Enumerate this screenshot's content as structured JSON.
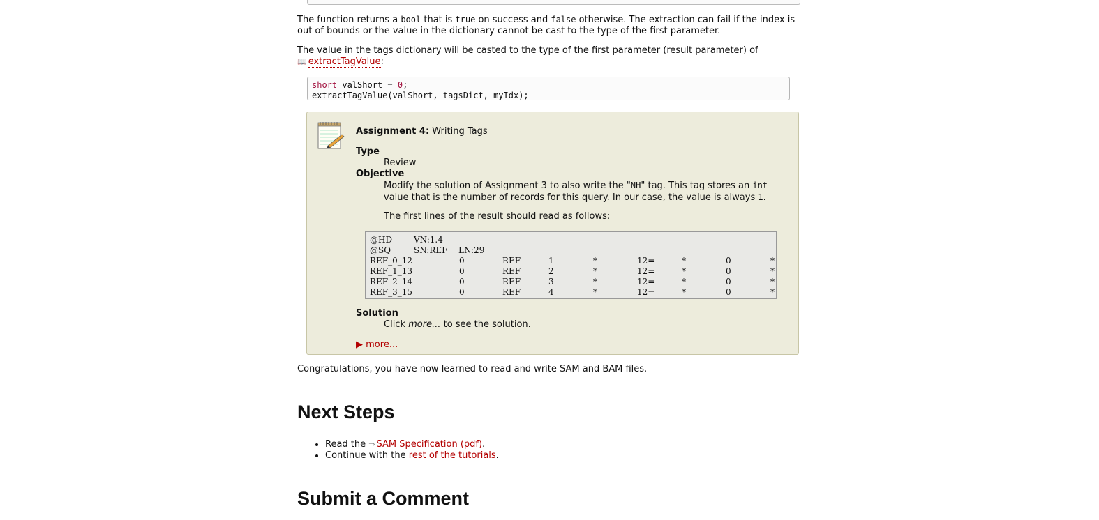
{
  "para1": {
    "t1": "The function returns a ",
    "c1": "bool",
    "t2": " that is ",
    "c2": "true",
    "t3": " on success and ",
    "c3": "false",
    "t4": " otherwise. The extraction can fail if the index is out of bounds or the value in the dictionary cannot be cast to the type of the first parameter."
  },
  "para2": {
    "t1": "The value in the tags dictionary will be casted to the type of the first parameter (result parameter) of",
    "link": "extractTagValue",
    "t2": ":"
  },
  "code": {
    "kw": "short",
    "line1_rest": " valShort = ",
    "num": "0",
    "semi": ";",
    "line2": "extractTagValue(valShort, tagsDict, myIdx);"
  },
  "assignment": {
    "title_bold": "Assignment 4:",
    "title_rest": " Writing Tags",
    "type_label": "Type",
    "type_value": "Review",
    "objective_label": "Objective",
    "obj_t1": "Modify the solution of Assignment 3 to also write the \"",
    "obj_c1": "NH",
    "obj_t2": "\" tag. This tag stores an ",
    "obj_c2": "int",
    "obj_t3": "value that is the number of records for this query. In our case, the value is always ",
    "obj_c3": "1",
    "obj_t4": ".",
    "obj_p2": "The first lines of the result should read as follows:",
    "sam_header": [
      {
        "c1": "@HD",
        "c2": "VN:1.4",
        "c3": ""
      },
      {
        "c1": "@SQ",
        "c2": "SN:REF",
        "c3": "LN:29"
      }
    ],
    "sam_rows": [
      [
        "REF_0_12",
        "0",
        "REF",
        "1",
        "*",
        "12=",
        "*",
        "0",
        "*"
      ],
      [
        "REF_1_13",
        "0",
        "REF",
        "2",
        "*",
        "12=",
        "*",
        "0",
        "*"
      ],
      [
        "REF_2_14",
        "0",
        "REF",
        "3",
        "*",
        "12=",
        "*",
        "0",
        "*"
      ],
      [
        "REF_3_15",
        "0",
        "REF",
        "4",
        "*",
        "12=",
        "*",
        "0",
        "*"
      ]
    ],
    "solution_label": "Solution",
    "sol_t1": "Click ",
    "sol_em": "more...",
    "sol_t2": " to see the solution.",
    "more_label": "more..."
  },
  "congrats": "Congratulations, you have now learned to read and write SAM and BAM files.",
  "next_steps": {
    "heading": "Next Steps",
    "item1_pre": "Read the ",
    "item1_link": "SAM Specification (pdf)",
    "item1_post": ".",
    "item2_pre": "Continue with the ",
    "item2_link": "rest of the tutorials",
    "item2_post": "."
  },
  "submit_heading": "Submit a Comment"
}
